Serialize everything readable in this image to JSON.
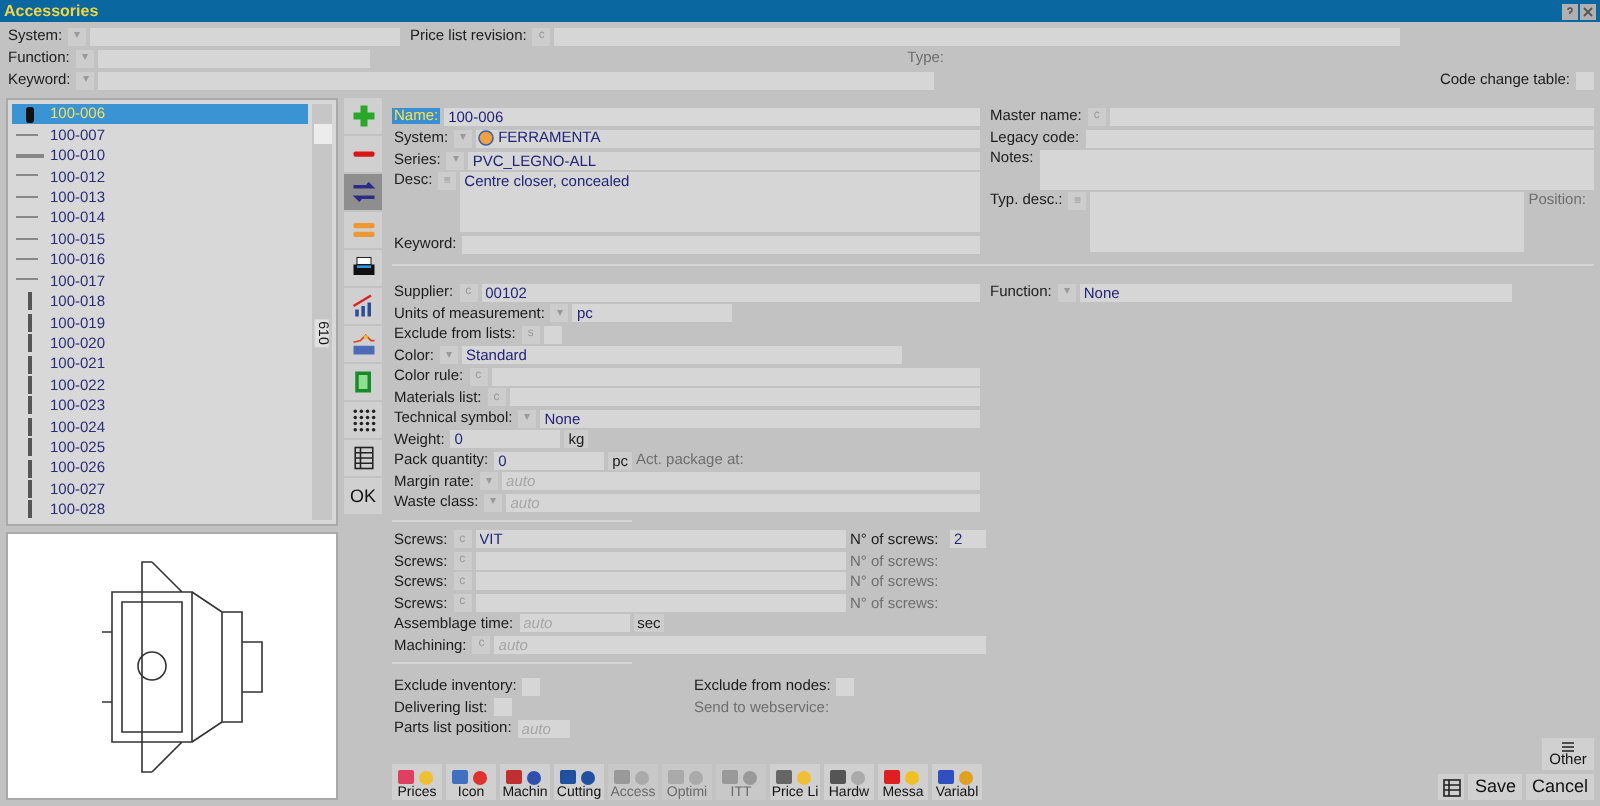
{
  "window": {
    "title": "Accessories"
  },
  "filters": [
    {
      "label": "System:",
      "button": "▾",
      "kind": "field"
    },
    {
      "label": "Price list revision:",
      "button": "c",
      "kind": "field"
    },
    {
      "label": "Function:",
      "button": "▾",
      "kind": "field"
    },
    {
      "label": "Type:",
      "disabled": true,
      "kind": "label"
    },
    {
      "label": "Keyword:",
      "button": "▾",
      "kind": "field"
    },
    {
      "label": "Code change table:",
      "checked": false,
      "kind": "check"
    }
  ],
  "tree": {
    "count": "610",
    "items": [
      {
        "code": "100-006",
        "selected": true
      },
      {
        "code": "100-007",
        "selected": false
      },
      {
        "code": "100-010",
        "selected": false
      },
      {
        "code": "100-012",
        "selected": false
      },
      {
        "code": "100-013",
        "selected": false
      },
      {
        "code": "100-014",
        "selected": false
      },
      {
        "code": "100-015",
        "selected": false
      },
      {
        "code": "100-016",
        "selected": false
      },
      {
        "code": "100-017",
        "selected": false
      },
      {
        "code": "100-018",
        "selected": false
      },
      {
        "code": "100-019",
        "selected": false
      },
      {
        "code": "100-020",
        "selected": false
      },
      {
        "code": "100-021",
        "selected": false
      },
      {
        "code": "100-022",
        "selected": false
      },
      {
        "code": "100-023",
        "selected": false
      },
      {
        "code": "100-024",
        "selected": false
      },
      {
        "code": "100-025",
        "selected": false
      },
      {
        "code": "100-026",
        "selected": false
      },
      {
        "code": "100-027",
        "selected": false
      },
      {
        "code": "100-028",
        "selected": false
      }
    ]
  },
  "toolbar": {
    "ok": "OK"
  },
  "top_left": [
    {
      "label": "Name:",
      "value": "100-006",
      "focused": true,
      "kind": "field"
    },
    {
      "label": "System:",
      "button": "▾",
      "value": "FERRAMENTA",
      "kind": "system"
    },
    {
      "label": "Series:",
      "button": "▾",
      "value": "PVC_LEGNO-ALL",
      "kind": "field"
    },
    {
      "label": "Desc:",
      "button": "≡",
      "value": "Centre closer, concealed",
      "kind": "area"
    },
    {
      "label": "Keyword:",
      "kind": "field"
    }
  ],
  "top_right": [
    {
      "label": "Master name:",
      "button": "c",
      "kind": "field"
    },
    {
      "label": "Legacy code:",
      "kind": "field"
    },
    {
      "label": "Notes:",
      "kind": "area2"
    },
    {
      "label": "Typ. desc.:",
      "button": "≡",
      "kind": "area",
      "side": "Position:"
    }
  ],
  "middle": [
    {
      "label": "Supplier:",
      "button": "c",
      "value": "00102",
      "kind": "field"
    },
    {
      "label": "Units of measurement:",
      "button": "▾",
      "value": "pc",
      "kind": "medium"
    },
    {
      "label": "Exclude from lists:",
      "button": "s",
      "checked": false,
      "kind": "check"
    },
    {
      "label": "Color:",
      "button": "▾",
      "value": "Standard",
      "kind": "wide"
    },
    {
      "label": "Color rule:",
      "button": "c",
      "kind": "field"
    },
    {
      "label": "Materials list:",
      "button": "c",
      "kind": "field"
    },
    {
      "label": "Technical symbol:",
      "button": "▾",
      "value": "None",
      "kind": "field"
    },
    {
      "label": "Weight:",
      "value": "0",
      "unit": "kg",
      "kind": "short"
    },
    {
      "label": "Pack quantity:",
      "value": "0",
      "unit": "pc",
      "side": "Act. package at:",
      "kind": "short"
    },
    {
      "label": "Margin rate:",
      "button": "▾",
      "placeholder": "auto",
      "kind": "field"
    },
    {
      "label": "Waste class:",
      "button": "▾",
      "placeholder": "auto",
      "kind": "field"
    }
  ],
  "function": {
    "label": "Function:",
    "button": "▾",
    "value": "None"
  },
  "screws": [
    {
      "label": "Screws:",
      "button": "c",
      "value": "VIT",
      "count_label": "N° of screws:",
      "count": "2",
      "disabled": false
    },
    {
      "label": "Screws:",
      "button": "c",
      "count_label": "N° of screws:",
      "disabled": true
    },
    {
      "label": "Screws:",
      "button": "c",
      "count_label": "N° of screws:",
      "disabled": true
    },
    {
      "label": "Screws:",
      "button": "c",
      "count_label": "N° of screws:",
      "disabled": true
    }
  ],
  "assembly": [
    {
      "label": "Assemblage time:",
      "placeholder": "auto",
      "unit": "sec",
      "kind": "short"
    },
    {
      "label": "Machining:",
      "button": "c",
      "placeholder": "auto",
      "kind": "field"
    }
  ],
  "options_left": [
    {
      "label": "Exclude inventory:",
      "checked": false,
      "kind": "check"
    },
    {
      "label": "Delivering list:",
      "checked": false,
      "kind": "check"
    },
    {
      "label": "Parts list position:",
      "placeholder": "auto",
      "kind": "tiny"
    }
  ],
  "options_right": [
    {
      "label": "Exclude from nodes:",
      "checked": false,
      "kind": "check"
    },
    {
      "label": "Send to webservice:",
      "disabled": true,
      "kind": "label"
    }
  ],
  "tabs": [
    {
      "label": "Prices",
      "disabled": false
    },
    {
      "label": "Icon",
      "disabled": false
    },
    {
      "label": "Machin",
      "disabled": false
    },
    {
      "label": "Cutting",
      "disabled": false
    },
    {
      "label": "Access",
      "disabled": true
    },
    {
      "label": "Optimi",
      "disabled": true
    },
    {
      "label": "ITT",
      "disabled": true
    },
    {
      "label": "Price Li",
      "disabled": false
    },
    {
      "label": "Hardw",
      "disabled": false
    },
    {
      "label": "Messa",
      "disabled": false
    },
    {
      "label": "Variabl",
      "disabled": false
    }
  ],
  "actions": {
    "other": "Other",
    "save": "Save",
    "cancel": "Cancel"
  }
}
